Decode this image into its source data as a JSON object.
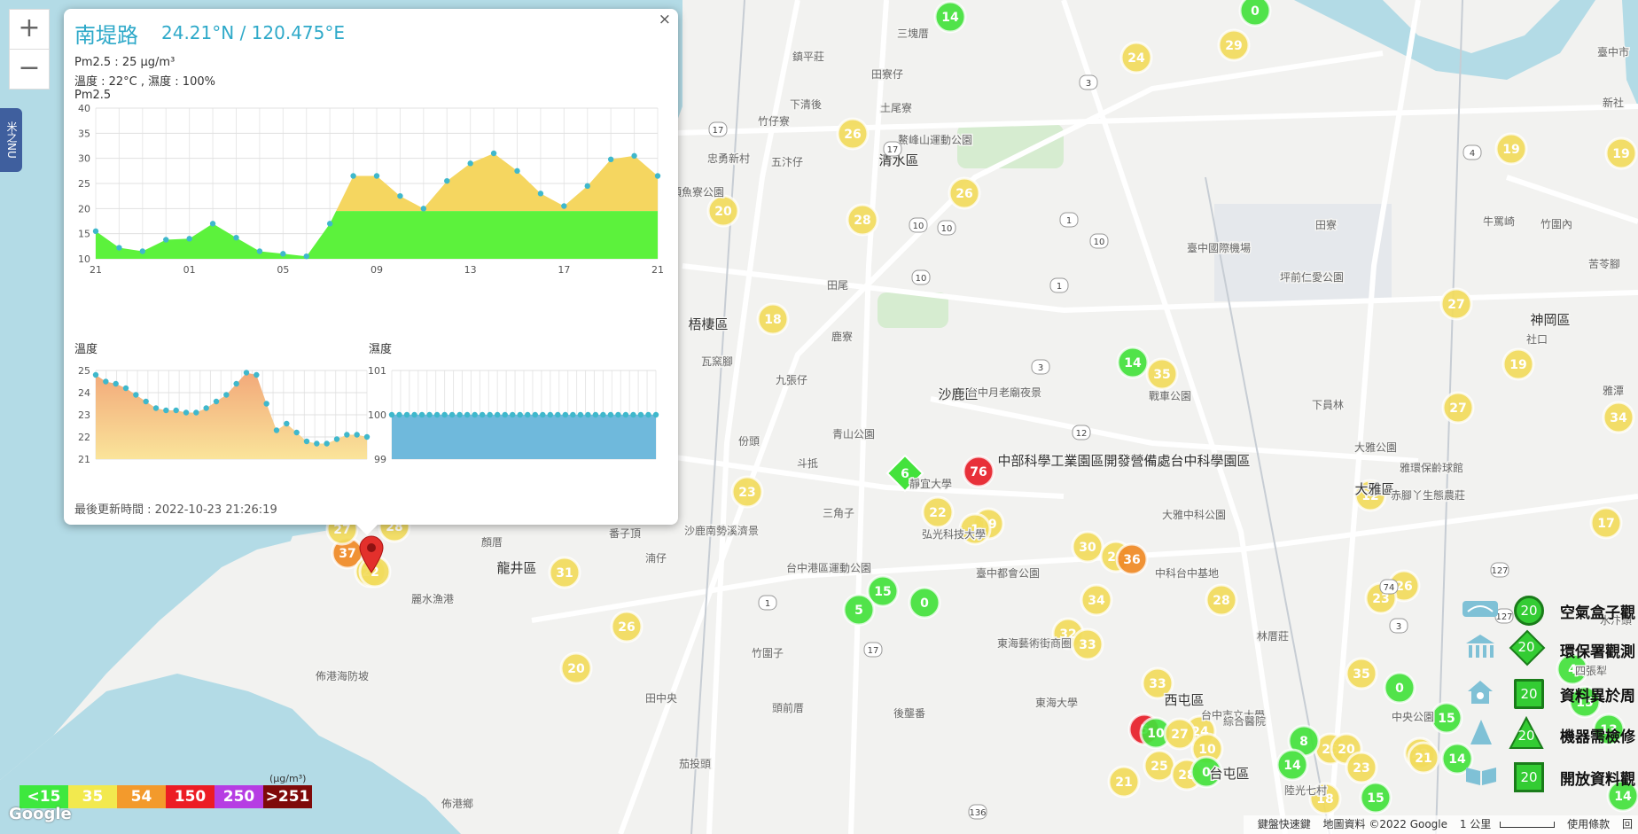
{
  "zoom": {
    "in": "+",
    "out": "−"
  },
  "side_tab": {
    "label": "米之NU"
  },
  "popup": {
    "title": "南堤路",
    "coords": "24.21°N / 120.475°E",
    "pm_line": "Pm2.5 : 25 μg/m³",
    "temp_hum_line": "溫度 : 22°C , 濕度 : 100%",
    "pm_chart_label": "Pm2.5",
    "temp_chart_label": "溫度",
    "hum_chart_label": "濕度",
    "updated": "最後更新時間 : 2022-10-23 21:26:19",
    "close": "×"
  },
  "chart_data": [
    {
      "type": "area",
      "title": "Pm2.5",
      "x_ticks": [
        "21",
        "01",
        "05",
        "09",
        "13",
        "17",
        "21"
      ],
      "y_ticks": [
        10,
        15,
        20,
        25,
        30,
        35,
        40
      ],
      "ylim": [
        10,
        40
      ],
      "threshold": 19.5,
      "colors": {
        "below": "#5cf23c",
        "above": "#f5d660",
        "point": "#3fb8cc"
      },
      "values": [
        15.5,
        12.2,
        11.5,
        13.8,
        14,
        17,
        14.2,
        11.5,
        11,
        10.5,
        17,
        26.5,
        26.5,
        22.5,
        20,
        25.5,
        29,
        31,
        27.5,
        23,
        20.5,
        24.5,
        29.8,
        30.5,
        26.5
      ]
    },
    {
      "type": "area",
      "title": "溫度",
      "y_ticks": [
        21,
        22,
        23,
        24,
        25
      ],
      "ylim": [
        21,
        25
      ],
      "colors": {
        "top": "#f2a97a",
        "bottom": "#fae49a",
        "point": "#3fb8cc"
      },
      "values": [
        24.8,
        24.5,
        24.4,
        24.2,
        23.9,
        23.6,
        23.3,
        23.2,
        23.2,
        23.1,
        23.1,
        23.3,
        23.6,
        23.9,
        24.4,
        24.9,
        24.8,
        23.5,
        22.3,
        22.6,
        22.2,
        21.8,
        21.7,
        21.7,
        21.9,
        22.1,
        22.1,
        22.0
      ]
    },
    {
      "type": "area",
      "title": "濕度",
      "y_ticks": [
        99,
        100,
        101
      ],
      "ylim": [
        99,
        101
      ],
      "colors": {
        "fill": "#6fb9dc",
        "point": "#3fb8cc"
      },
      "values": [
        100,
        100,
        100,
        100,
        100,
        100,
        100,
        100,
        100,
        100,
        100,
        100,
        100,
        100,
        100,
        100,
        100,
        100,
        100,
        100,
        100,
        100,
        100,
        100,
        100,
        100,
        100,
        100,
        100,
        100,
        100,
        100,
        100,
        100,
        100,
        100
      ]
    }
  ],
  "map_labels": [
    "三塊厝",
    "鎮平莊",
    "田寮仔",
    "下清後",
    "土尾寮",
    "竹仔寮",
    "鰲峰山運動公園",
    "忠勇新村",
    "五汴仔",
    "清水區",
    "頂魚寮公園",
    "梧棲區",
    "田尾",
    "鹿寮",
    "瓦窯腳",
    "九張仔",
    "份頭",
    "斗抵",
    "青山公園",
    "靜宜大學",
    "三角子",
    "弘光科技大學",
    "沙鹿南勢溪濟景",
    "龍井區",
    "顏厝",
    "番子頂",
    "湳仔",
    "台中港區運動公園",
    "麗水漁港",
    "竹圍子",
    "佈港海防坡",
    "田中央",
    "頭前厝",
    "後壟番",
    "茄投頭",
    "佈港鄉",
    "沙鹿區",
    "台中月老廟夜景",
    "戰車公園",
    "臺中國際機場",
    "坪前仁愛公園",
    "田寮",
    "牛罵崎",
    "竹圍內",
    "苦苓腳",
    "神岡區",
    "社口",
    "下員林",
    "大雅公園",
    "雅環保齡球館",
    "大雅區",
    "中部科學工業園區開發營備處台中科學園區",
    "大雅中科公園",
    "赤腳丫生態農莊",
    "中科台中基地",
    "臺中都會公園",
    "東海藝術街商圈",
    "東海大學",
    "林厝莊",
    "台中市立大學",
    "綜合醫院",
    "中央公園",
    "台屯區",
    "陸光七村",
    "西屯區",
    "水汴頭",
    "四張犁",
    "臺中市",
    "新社",
    "雅潭"
  ],
  "markers": [
    {
      "v": "14",
      "c": "green"
    },
    {
      "v": "0",
      "c": "green"
    },
    {
      "v": "29",
      "c": "yellow"
    },
    {
      "v": "24",
      "c": "yellow"
    },
    {
      "v": "26",
      "c": "yellow"
    },
    {
      "v": "26",
      "c": "yellow"
    },
    {
      "v": "20",
      "c": "yellow"
    },
    {
      "v": "28",
      "c": "yellow"
    },
    {
      "v": "18",
      "c": "yellow"
    },
    {
      "v": "19",
      "c": "yellow"
    },
    {
      "v": "19",
      "c": "yellow"
    },
    {
      "v": "27",
      "c": "yellow"
    },
    {
      "v": "14",
      "c": "green"
    },
    {
      "v": "35",
      "c": "yellow"
    },
    {
      "v": "19",
      "c": "yellow"
    },
    {
      "v": "27",
      "c": "yellow"
    },
    {
      "v": "34",
      "c": "yellow"
    },
    {
      "v": "6",
      "c": "diamond"
    },
    {
      "v": "76",
      "c": "red"
    },
    {
      "v": "23",
      "c": "yellow"
    },
    {
      "v": "22",
      "c": "yellow"
    },
    {
      "v": "19",
      "c": "yellow"
    },
    {
      "v": "1",
      "c": "yellow"
    },
    {
      "v": "12",
      "c": "yellow"
    },
    {
      "v": "17",
      "c": "yellow"
    },
    {
      "v": "30",
      "c": "yellow"
    },
    {
      "v": "25",
      "c": "yellow"
    },
    {
      "v": "36",
      "c": "orange"
    },
    {
      "v": "26",
      "c": "yellow"
    },
    {
      "v": "31",
      "c": "yellow"
    },
    {
      "v": "15",
      "c": "green"
    },
    {
      "v": "5",
      "c": "green"
    },
    {
      "v": "0",
      "c": "green"
    },
    {
      "v": "34",
      "c": "yellow"
    },
    {
      "v": "28",
      "c": "yellow"
    },
    {
      "v": "23",
      "c": "yellow"
    },
    {
      "v": "32",
      "c": "yellow"
    },
    {
      "v": "33",
      "c": "yellow"
    },
    {
      "v": "26",
      "c": "yellow"
    },
    {
      "v": "20",
      "c": "yellow"
    },
    {
      "v": "35",
      "c": "yellow"
    },
    {
      "v": "0",
      "c": "green"
    },
    {
      "v": "33",
      "c": "yellow"
    },
    {
      "v": "24",
      "c": "yellow"
    },
    {
      "v": "5",
      "c": "red"
    },
    {
      "v": "10",
      "c": "green"
    },
    {
      "v": "27",
      "c": "yellow"
    },
    {
      "v": "10",
      "c": "yellow"
    },
    {
      "v": "25",
      "c": "yellow"
    },
    {
      "v": "28",
      "c": "yellow"
    },
    {
      "v": "0",
      "c": "green"
    },
    {
      "v": "25",
      "c": "yellow"
    },
    {
      "v": "21",
      "c": "yellow"
    },
    {
      "v": "8",
      "c": "green"
    },
    {
      "v": "14",
      "c": "green"
    },
    {
      "v": "20",
      "c": "yellow"
    },
    {
      "v": "23",
      "c": "yellow"
    },
    {
      "v": "18",
      "c": "yellow"
    },
    {
      "v": "15",
      "c": "green"
    },
    {
      "v": "22",
      "c": "yellow"
    },
    {
      "v": "15",
      "c": "green"
    },
    {
      "v": "14",
      "c": "green"
    },
    {
      "v": "21",
      "c": "yellow"
    },
    {
      "v": "4",
      "c": "green"
    },
    {
      "v": "15",
      "c": "green"
    },
    {
      "v": "13",
      "c": "green"
    },
    {
      "v": "14",
      "c": "green"
    },
    {
      "v": "37",
      "c": "orange"
    },
    {
      "v": "27",
      "c": "yellow"
    },
    {
      "v": "28",
      "c": "yellow"
    },
    {
      "v": "25",
      "c": "yellow"
    },
    {
      "v": "2",
      "c": "yellow"
    }
  ],
  "road_numbers": [
    "3",
    "3",
    "12",
    "10",
    "10",
    "1",
    "17",
    "17",
    "1",
    "17",
    "10",
    "1",
    "4",
    "10",
    "74",
    "127",
    "127",
    "136",
    "3"
  ],
  "legend": [
    {
      "label": "<15",
      "color": "#3ee83e"
    },
    {
      "label": "35",
      "color": "#f2e94e"
    },
    {
      "label": "54",
      "color": "#f39a2c"
    },
    {
      "label": "150",
      "color": "#ec1c24"
    },
    {
      "label": "250",
      "color": "#b63de3"
    },
    {
      "label": ">251",
      "color": "#7f0a0a"
    }
  ],
  "legend_unit": "(μg/m³)",
  "map_legend": [
    {
      "num": "20",
      "label": "空氣盒子觀"
    },
    {
      "num": "20",
      "label": "環保署觀測"
    },
    {
      "num": "20",
      "label": "資料異於周"
    },
    {
      "num": "20",
      "label": "機器需檢修"
    },
    {
      "num": "20",
      "label": "開放資料觀"
    }
  ],
  "google": "Google",
  "attribution": {
    "shortcuts": "鍵盤快速鍵",
    "mapdata": "地圖資料 ©2022 Google",
    "scale": "1 公里",
    "terms": "使用條款",
    "report": "回"
  }
}
